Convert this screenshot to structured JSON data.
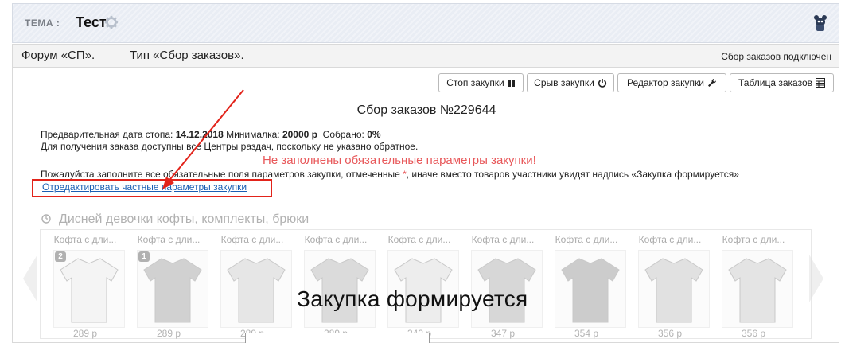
{
  "topic": {
    "label": "ТЕМА :",
    "title": "Тест"
  },
  "forum": {
    "left": "Форум «СП».",
    "type": "Тип «Сбор заказов».",
    "status": "Сбор заказов подключен"
  },
  "toolbar": {
    "stop_label": "Стоп закупки",
    "cancel_label": "Срыв закупки",
    "editor_label": "Редактор закупки",
    "table_label": "Таблица заказов"
  },
  "purchase": {
    "title": "Сбор заказов №229644",
    "stop_date_label": "Предварительная дата стопа:",
    "stop_date": "14.12.2018",
    "minimum_label": "Минималка:",
    "minimum": "20000 р",
    "collected_label": "Собрано:",
    "collected": "0%",
    "pickup_note": "Для получения заказа доступны все Центры раздач, поскольку не указано обратное.",
    "warning": "Не заполнены обязательные параметры закупки!",
    "notice_before": "Пожалуйста заполните все обязательные поля параметров закупки, отмеченные",
    "notice_star": "*",
    "notice_after": ", иначе вместо товаров участники увидят надпись «Закупка формируется»",
    "edit_link": "Отредактировать частные параметры закупки"
  },
  "catalog": {
    "section_title": "Дисней девочки кофты, комплекты, брюки",
    "overlay": "Закупка формируется",
    "items": [
      {
        "name": "Кофта с дли...",
        "price": "289 р",
        "badge": "2"
      },
      {
        "name": "Кофта с дли...",
        "price": "289 р",
        "badge": "1"
      },
      {
        "name": "Кофта с дли...",
        "price": "289 р",
        "badge": ""
      },
      {
        "name": "Кофта с дли...",
        "price": "289 р",
        "badge": ""
      },
      {
        "name": "Кофта с дли...",
        "price": "342 р",
        "badge": ""
      },
      {
        "name": "Кофта с дли...",
        "price": "347 р",
        "badge": ""
      },
      {
        "name": "Кофта с дли...",
        "price": "354 р",
        "badge": ""
      },
      {
        "name": "Кофта с дли...",
        "price": "356 р",
        "badge": ""
      },
      {
        "name": "Кофта с дли...",
        "price": "356 р",
        "badge": ""
      }
    ]
  },
  "colors": {
    "warning": "#e8585a",
    "link": "#1a5fb4",
    "annotation": "#e2231a"
  }
}
